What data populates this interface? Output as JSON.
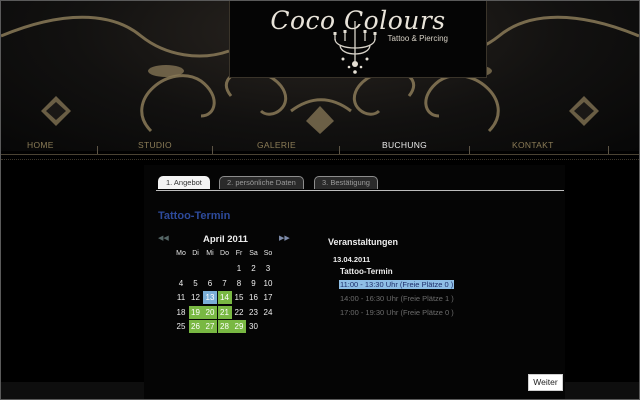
{
  "brand": {
    "title": "Coco Colours",
    "subtitle": "Tattoo & Piercing"
  },
  "nav": {
    "items": [
      "HOME",
      "STUDIO",
      "GALERIE",
      "BUCHUNG",
      "KONTAKT"
    ],
    "active": "BUCHUNG"
  },
  "tabs": [
    "1. Angebot",
    "2. persönliche Daten",
    "3. Bestätigung"
  ],
  "section_title": "Tattoo-Termin",
  "calendar": {
    "prev": "◀◀",
    "next": "▶▶",
    "month": "April 2011",
    "weekdays": [
      "Mo",
      "Di",
      "Mi",
      "Do",
      "Fr",
      "Sa",
      "So"
    ],
    "weeks": [
      [
        "",
        "",
        "",
        "",
        "1",
        "2",
        "3"
      ],
      [
        "4",
        "5",
        "6",
        "7",
        "8",
        "9",
        "10"
      ],
      [
        "11",
        "12",
        "13",
        "14",
        "15",
        "16",
        "17"
      ],
      [
        "18",
        "19",
        "20",
        "21",
        "22",
        "23",
        "24"
      ],
      [
        "25",
        "26",
        "27",
        "28",
        "29",
        "30",
        ""
      ]
    ],
    "selected_day": "13",
    "available_days": [
      "14",
      "19",
      "20",
      "21",
      "26",
      "27",
      "28",
      "29"
    ],
    "colors": {
      "available": "#79b843",
      "selected": "#7aaed7"
    }
  },
  "events": {
    "title": "Veranstaltungen",
    "date": "13.04.2011",
    "name": "Tattoo-Termin",
    "slots": [
      "11:00 - 13:30 Uhr (Freie Plätze 0 )",
      "14:00 - 16:30 Uhr (Freie Plätze 1 )",
      "17:00 - 19:30 Uhr (Freie Plätze 0 )"
    ],
    "selected_slot": 0
  },
  "next_button": "Weiter",
  "icons": {
    "logo": "chandelier-icon",
    "ornament": "ornament-decoration"
  }
}
